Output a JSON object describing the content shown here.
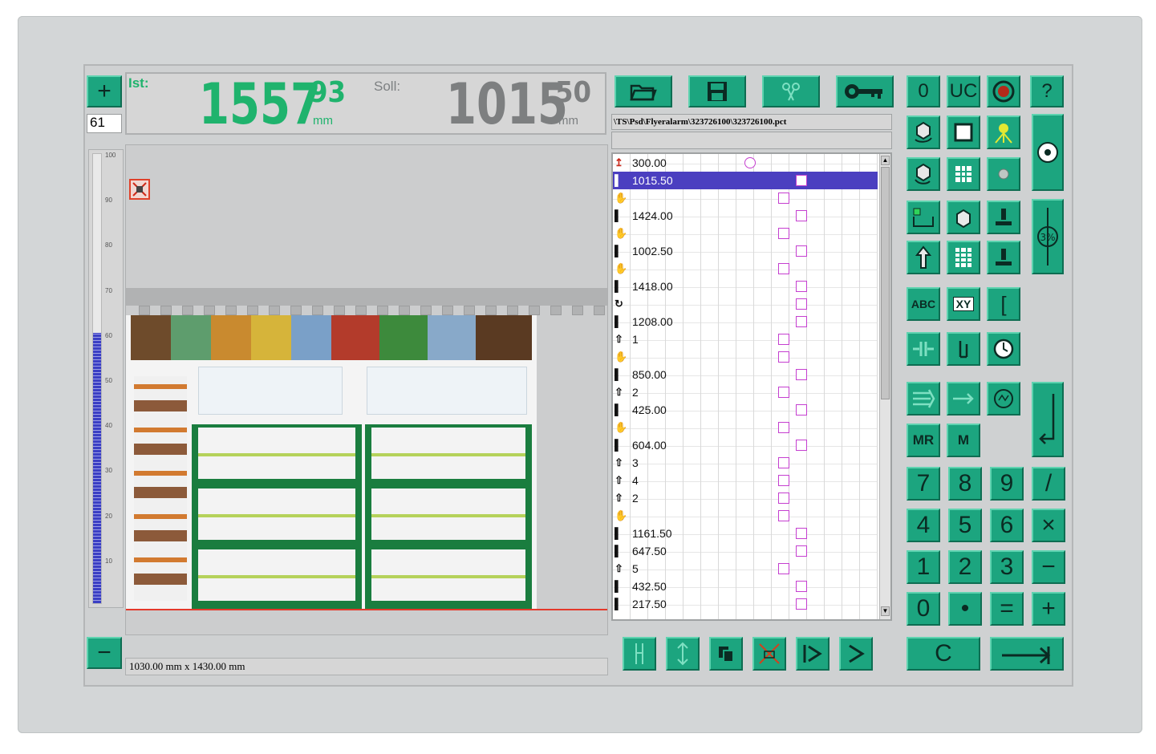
{
  "colors": {
    "accent_green": "#1ca57f",
    "readout_green": "#1fb36d",
    "selection": "#4b3fc0"
  },
  "readout": {
    "ist_label": "Ist:",
    "ist_int": "1557",
    "ist_dec": "93",
    "ist_unit": "mm",
    "soll_label": "Soll:",
    "soll_int": "1015",
    "soll_dec": "50",
    "soll_unit": "mm"
  },
  "left_panel": {
    "plus_label": "+",
    "minus_label": "−",
    "counter_value": "61",
    "scale_ticks": [
      "100",
      "90",
      "80",
      "70",
      "60",
      "50",
      "40",
      "30",
      "20",
      "10"
    ],
    "scale_fill_fraction": 0.6,
    "sheet_size": "1030.00 mm x 1430.00 mm",
    "icon_warning": "cross-out-icon",
    "icon_eject": "eject-icon"
  },
  "file_path": "\\TS\\Psd\\Flyeralarm\\323726100\\323726100.pct",
  "program_rows": [
    {
      "icon": "knife-down-icon",
      "value": "300.00"
    },
    {
      "icon": "cut-icon",
      "value": "1015.50",
      "selected": true
    },
    {
      "icon": "pusher-icon",
      "value": ""
    },
    {
      "icon": "cut-icon",
      "value": "1424.00"
    },
    {
      "icon": "pusher-icon",
      "value": ""
    },
    {
      "icon": "cut-icon",
      "value": "1002.50"
    },
    {
      "icon": "pusher-icon",
      "value": ""
    },
    {
      "icon": "cut-icon",
      "value": "1418.00"
    },
    {
      "icon": "rotate-icon",
      "value": ""
    },
    {
      "icon": "cut-icon",
      "value": "1208.00"
    },
    {
      "icon": "repeat-icon",
      "value": "1"
    },
    {
      "icon": "pusher-icon",
      "value": ""
    },
    {
      "icon": "cut-icon",
      "value": "850.00"
    },
    {
      "icon": "repeat-icon",
      "value": "2"
    },
    {
      "icon": "cut-icon",
      "value": "425.00"
    },
    {
      "icon": "pusher-icon",
      "value": ""
    },
    {
      "icon": "cut-icon",
      "value": "604.00"
    },
    {
      "icon": "repeat-icon",
      "value": "3"
    },
    {
      "icon": "repeat-icon",
      "value": "4"
    },
    {
      "icon": "repeat-icon",
      "value": "2"
    },
    {
      "icon": "pusher-icon",
      "value": ""
    },
    {
      "icon": "cut-icon",
      "value": "1161.50"
    },
    {
      "icon": "cut-icon",
      "value": "647.50"
    },
    {
      "icon": "repeat-icon",
      "value": "5"
    },
    {
      "icon": "cut-icon",
      "value": "432.50"
    },
    {
      "icon": "cut-icon",
      "value": "217.50"
    }
  ],
  "toolbar_top": [
    "open-folder-icon",
    "save-icon",
    "scissors-icon",
    "settings-key-icon"
  ],
  "toolbar_bottom": [
    "cut-icon",
    "clamp-icon",
    "copy-icon",
    "delete-icon",
    "step-forward-icon",
    "next-icon"
  ],
  "keypad": {
    "top_row": [
      "0",
      "UC"
    ],
    "abc": "ABC",
    "xy": "XY",
    "mr": "MR",
    "m": "M",
    "digits": [
      "7",
      "8",
      "9",
      "/",
      "4",
      "5",
      "6",
      "×",
      "1",
      "2",
      "3",
      "−",
      "0",
      "•",
      "=",
      "+"
    ],
    "clear": "C",
    "help": "?"
  }
}
